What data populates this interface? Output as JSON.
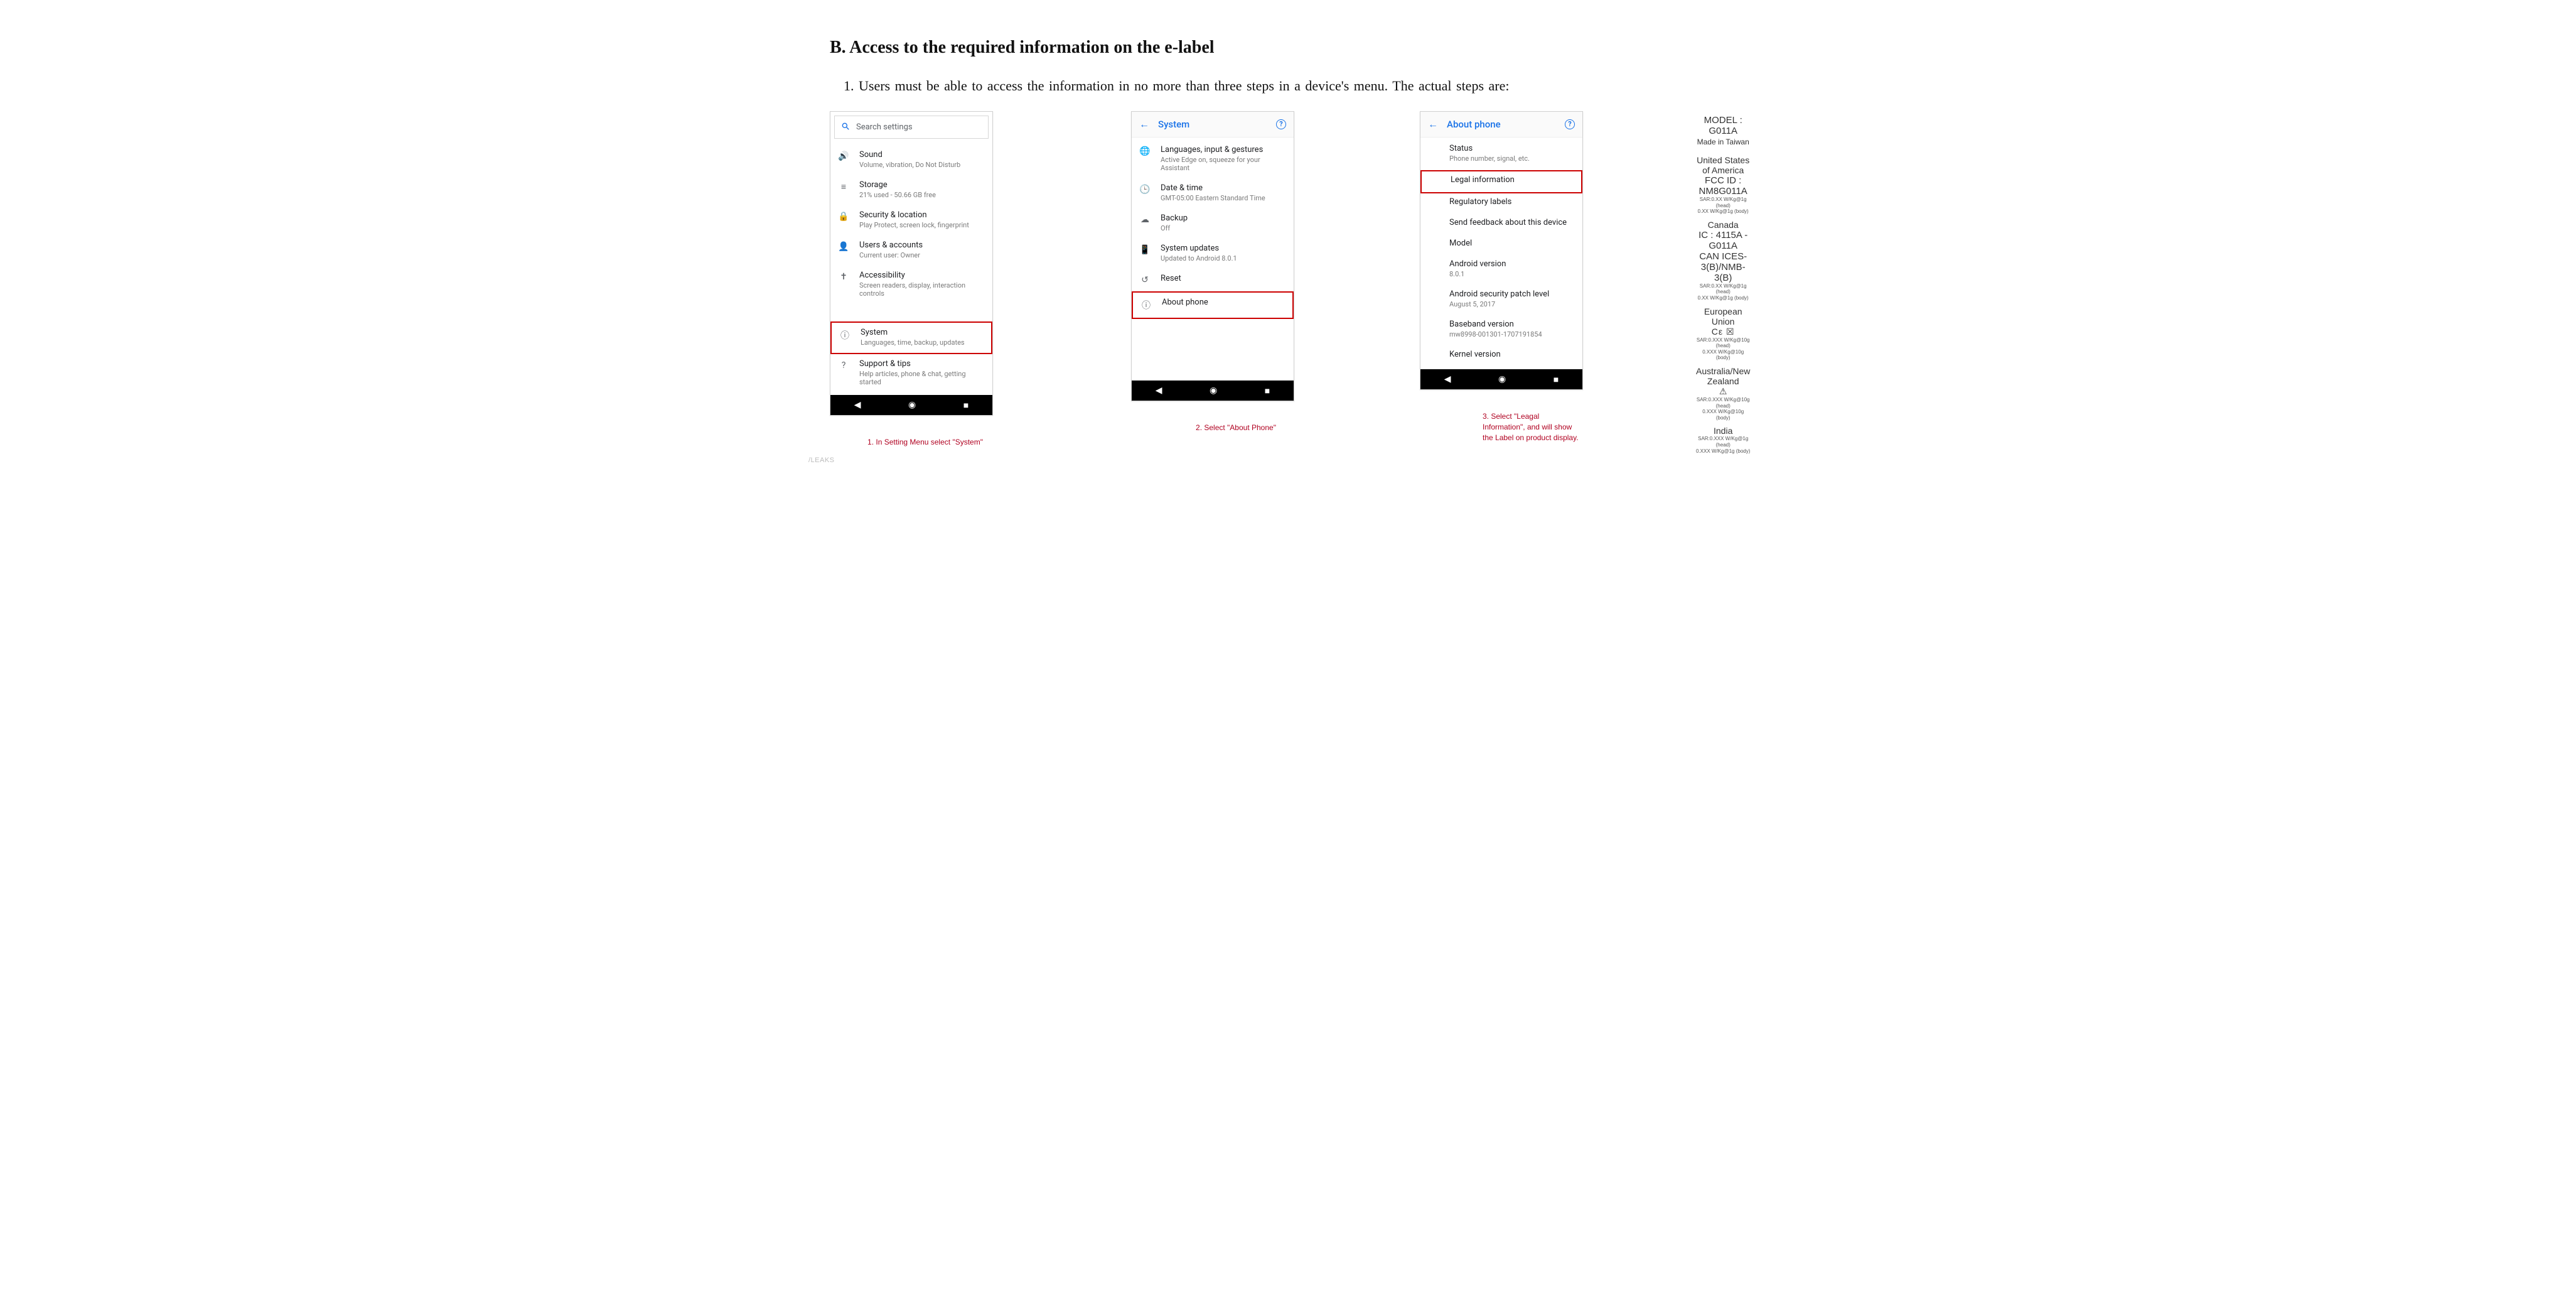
{
  "heading": "B. Access to the required information on the e-label",
  "subtext": "1. Users must be able to access the information in no more than three steps in a device's menu. The actual steps are:",
  "screens": {
    "s1": {
      "search_placeholder": "Search settings",
      "items": [
        {
          "icon": "volume-icon",
          "t1": "Sound",
          "t2": "Volume, vibration, Do Not Disturb"
        },
        {
          "icon": "storage-icon",
          "t1": "Storage",
          "t2": "21% used - 50.66 GB free"
        },
        {
          "icon": "lock-icon",
          "t1": "Security & location",
          "t2": "Play Protect, screen lock, fingerprint"
        },
        {
          "icon": "user-icon",
          "t1": "Users & accounts",
          "t2": "Current user: Owner"
        },
        {
          "icon": "accessibility-icon",
          "t1": "Accessibility",
          "t2": "Screen readers, display, interaction controls"
        },
        {
          "icon": "info-icon",
          "t1": "System",
          "t2": "Languages, time, backup, updates",
          "hl": true
        },
        {
          "icon": "help-icon",
          "t1": "Support & tips",
          "t2": "Help articles, phone & chat, getting started"
        }
      ],
      "caption": "1. In Setting Menu select \"System\""
    },
    "s2": {
      "title": "System",
      "items": [
        {
          "icon": "globe-icon",
          "t1": "Languages, input & gestures",
          "t2": "Active Edge on, squeeze for your Assistant"
        },
        {
          "icon": "clock-icon",
          "t1": "Date & time",
          "t2": "GMT-05:00 Eastern Standard Time"
        },
        {
          "icon": "cloud-icon",
          "t1": "Backup",
          "t2": "Off"
        },
        {
          "icon": "phone-icon",
          "t1": "System updates",
          "t2": "Updated to Android 8.0.1"
        },
        {
          "icon": "reset-icon",
          "t1": "Reset",
          "t2": ""
        },
        {
          "icon": "info-icon",
          "t1": "About phone",
          "t2": "",
          "hl": true
        }
      ],
      "caption": "2. Select \"About Phone\""
    },
    "s3": {
      "title": "About phone",
      "items": [
        {
          "t1": "Status",
          "t2": "Phone number, signal, etc."
        },
        {
          "t1": "Legal information",
          "t2": "",
          "hl": true
        },
        {
          "t1": "Regulatory labels",
          "t2": ""
        },
        {
          "t1": "Send feedback about this device",
          "t2": ""
        },
        {
          "t1": "Model",
          "t2": ""
        },
        {
          "t1": "Android version",
          "t2": "8.0.1"
        },
        {
          "t1": "Android security patch level",
          "t2": "August 5, 2017"
        },
        {
          "t1": "Baseband version",
          "t2": "mw8998-001301-1707191854"
        },
        {
          "t1": "Kernel version",
          "t2": ""
        }
      ],
      "caption": "3. Select \"Leagal Information\", and will show the Label on product display."
    }
  },
  "label": {
    "model": "MODEL : G011A",
    "made": "Made in Taiwan",
    "us_region": "United States of America",
    "us_fcc": "FCC ID : NM8G011A",
    "us_sar1": "SAR:0.XX W/Kg@1g (head)",
    "us_sar2": "0.XX W/Kg@1g (body)",
    "ca_region": "Canada",
    "ca_ic": "IC : 4115A - G011A",
    "ca_ices": "CAN ICES-3(B)/NMB-3(B)",
    "ca_sar1": "SAR:0.XX W/Kg@1g (head)",
    "ca_sar2": "0.XX W/Kg@1g (body)",
    "eu_region": "European Union",
    "eu_mark": "Cε ☒",
    "eu_sar1": "SAR:0.XXX W/Kg@10g (head)",
    "eu_sar2": "0.XXX W/Kg@10g (body)",
    "anz_region": "Australia/New Zealand",
    "anz_mark": "⚠",
    "anz_sar1": "SAR:0.XXX W/Kg@10g (head)",
    "anz_sar2": "0.XXX W/Kg@10g (body)",
    "in_region": "India",
    "in_sar1": "SAR:0.XXX W/Kg@1g (head)",
    "in_sar2": "0.XXX W/Kg@1g (body)"
  },
  "watermark": "/LEAKS"
}
